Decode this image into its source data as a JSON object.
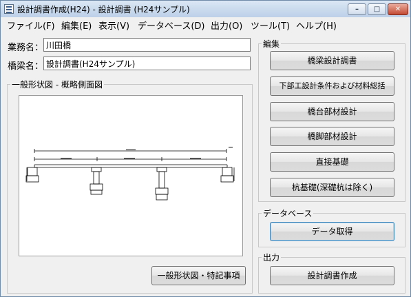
{
  "window": {
    "title": "設計調書作成(H24) - 設計調書 (H24サンプル)",
    "minimize_glyph": "–",
    "maximize_glyph": "□",
    "close_glyph": "✕"
  },
  "menu": {
    "items": [
      {
        "label": "ファイル(F)"
      },
      {
        "label": "編集(E)"
      },
      {
        "label": "表示(V)"
      },
      {
        "label": "データベース(D)"
      },
      {
        "label": "出力(O)"
      },
      {
        "label": "ツール(T)"
      },
      {
        "label": "ヘルプ(H)"
      }
    ]
  },
  "form": {
    "project_label": "業務名：",
    "project_value": "川田橋",
    "bridge_label": "橋梁名：",
    "bridge_value": "設計調書(H24サンプル)"
  },
  "drawing_panel": {
    "title": "一般形状図 - 概略側面図",
    "button_label": "一般形状図・特記事項"
  },
  "edit_group": {
    "title": "編集",
    "buttons": [
      {
        "label": "橋梁設計調書"
      },
      {
        "label": "下部工設計条件および材料総括"
      },
      {
        "label": "橋台部材設計"
      },
      {
        "label": "橋脚部材設計"
      },
      {
        "label": "直接基礎"
      },
      {
        "label": "杭基礎(深礎杭は除く)"
      }
    ]
  },
  "database_group": {
    "title": "データベース",
    "buttons": [
      {
        "label": "データ取得"
      }
    ]
  },
  "output_group": {
    "title": "出力",
    "buttons": [
      {
        "label": "設計調書作成"
      }
    ]
  }
}
